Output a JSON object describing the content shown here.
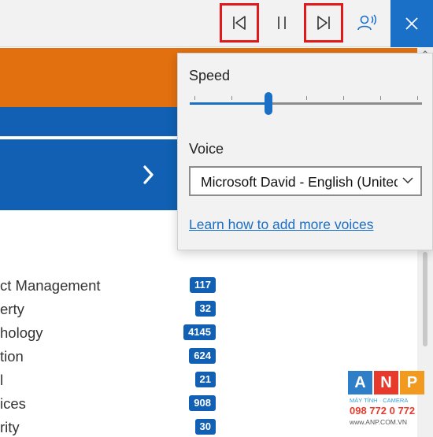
{
  "toolbar": {
    "buttons": [
      {
        "name": "previous",
        "icon": "skip-previous-icon"
      },
      {
        "name": "pause",
        "icon": "pause-icon"
      },
      {
        "name": "next",
        "icon": "skip-next-icon"
      },
      {
        "name": "voice_settings",
        "icon": "voice-settings-icon"
      },
      {
        "name": "close",
        "icon": "close-icon"
      }
    ],
    "highlight_color": "#e01a1a",
    "accent": "#1a6fc6"
  },
  "flyout": {
    "speed_label": "Speed",
    "speed_level": 0.34,
    "voice_label": "Voice",
    "voice_value": "Microsoft David - English (United States)",
    "link_text": "Learn how to add more voices"
  },
  "page": {
    "colors": {
      "orange": "#e2700f",
      "blue": "#1160b3"
    },
    "categories": [
      {
        "label": "ct Management",
        "count": "117"
      },
      {
        "label": "erty",
        "count": "32"
      },
      {
        "label": "hology",
        "count": "4145"
      },
      {
        "label": "tion",
        "count": "624"
      },
      {
        "label": "l",
        "count": "21"
      },
      {
        "label": "ices",
        "count": "908"
      },
      {
        "label": "rity",
        "count": "30"
      }
    ]
  },
  "watermark": {
    "letters": [
      "A",
      "N",
      "P"
    ],
    "letter_colors": [
      "#2f7fc8",
      "#e83a2c",
      "#f29a1f"
    ],
    "line1": "MÁY TÍNH · CAMERA",
    "phone": "098 772 0 772",
    "website": "www.ANP.COM.VN"
  }
}
